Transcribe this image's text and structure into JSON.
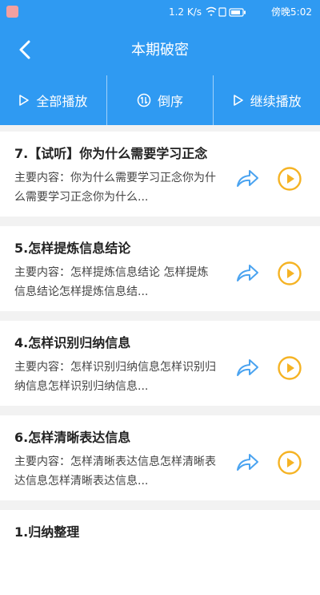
{
  "status": {
    "network": "1.2 K/s",
    "time": "傍晚5:02"
  },
  "header": {
    "title": "本期破密"
  },
  "toolbar": {
    "play_all": "全部播放",
    "reverse": "倒序",
    "continue": "继续播放"
  },
  "items": [
    {
      "title": "7.【试听】你为什么需要学习正念",
      "desc": "主要内容：你为什么需要学习正念你为什么需要学习正念你为什么..."
    },
    {
      "title": "5.怎样提炼信息结论",
      "desc": "主要内容：怎样提炼信息结论 怎样提炼信息结论怎样提炼信息结..."
    },
    {
      "title": "4.怎样识别归纳信息",
      "desc": "主要内容：怎样识别归纳信息怎样识别归纳信息怎样识别归纳信息..."
    },
    {
      "title": "6.怎样清晰表达信息",
      "desc": "主要内容：怎样清晰表达信息怎样清晰表达信息怎样清晰表达信息..."
    },
    {
      "title": "1.归纳整理",
      "desc": ""
    }
  ],
  "colors": {
    "primary": "#2f9af2",
    "share": "#4aa3f0",
    "play": "#f5b324"
  }
}
